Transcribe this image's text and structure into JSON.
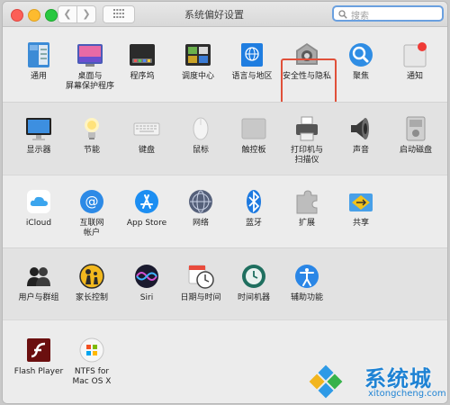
{
  "window": {
    "title": "系统偏好设置",
    "search_placeholder": "搜索"
  },
  "sections": [
    [
      {
        "label": "通用",
        "icon": "general-icon"
      },
      {
        "label": "桌面与\n屏幕保护程序",
        "icon": "desktop-screensaver-icon"
      },
      {
        "label": "程序坞",
        "icon": "dock-icon"
      },
      {
        "label": "调度中心",
        "icon": "mission-control-icon"
      },
      {
        "label": "语言与地区",
        "icon": "language-region-icon"
      },
      {
        "label": "安全性与隐私",
        "icon": "security-privacy-icon"
      },
      {
        "label": "聚焦",
        "icon": "spotlight-icon"
      },
      {
        "label": "通知",
        "icon": "notifications-icon"
      }
    ],
    [
      {
        "label": "显示器",
        "icon": "displays-icon"
      },
      {
        "label": "节能",
        "icon": "energy-saver-icon"
      },
      {
        "label": "键盘",
        "icon": "keyboard-icon"
      },
      {
        "label": "鼠标",
        "icon": "mouse-icon"
      },
      {
        "label": "触控板",
        "icon": "trackpad-icon"
      },
      {
        "label": "打印机与\n扫描仪",
        "icon": "printer-scanner-icon"
      },
      {
        "label": "声音",
        "icon": "sound-icon"
      },
      {
        "label": "启动磁盘",
        "icon": "startup-disk-icon"
      }
    ],
    [
      {
        "label": "iCloud",
        "icon": "icloud-icon"
      },
      {
        "label": "互联网\n帐户",
        "icon": "internet-accounts-icon"
      },
      {
        "label": "App Store",
        "icon": "app-store-icon"
      },
      {
        "label": "网络",
        "icon": "network-icon"
      },
      {
        "label": "蓝牙",
        "icon": "bluetooth-icon"
      },
      {
        "label": "扩展",
        "icon": "extensions-icon"
      },
      {
        "label": "共享",
        "icon": "sharing-icon"
      }
    ],
    [
      {
        "label": "用户与群组",
        "icon": "users-groups-icon"
      },
      {
        "label": "家长控制",
        "icon": "parental-controls-icon"
      },
      {
        "label": "Siri",
        "icon": "siri-icon"
      },
      {
        "label": "日期与时间",
        "icon": "date-time-icon"
      },
      {
        "label": "时间机器",
        "icon": "time-machine-icon"
      },
      {
        "label": "辅助功能",
        "icon": "accessibility-icon"
      }
    ],
    [
      {
        "label": "Flash Player",
        "icon": "flash-player-icon"
      },
      {
        "label": "NTFS for\nMac OS X",
        "icon": "ntfs-icon"
      }
    ]
  ],
  "selected_pane": "安全性与隐私",
  "watermark": {
    "brand": "系统城",
    "url": "xitongcheng.com"
  },
  "colors": {
    "highlight": "#e0503a",
    "search_focus": "#6aa0df",
    "watermark": "#1f83d4"
  }
}
